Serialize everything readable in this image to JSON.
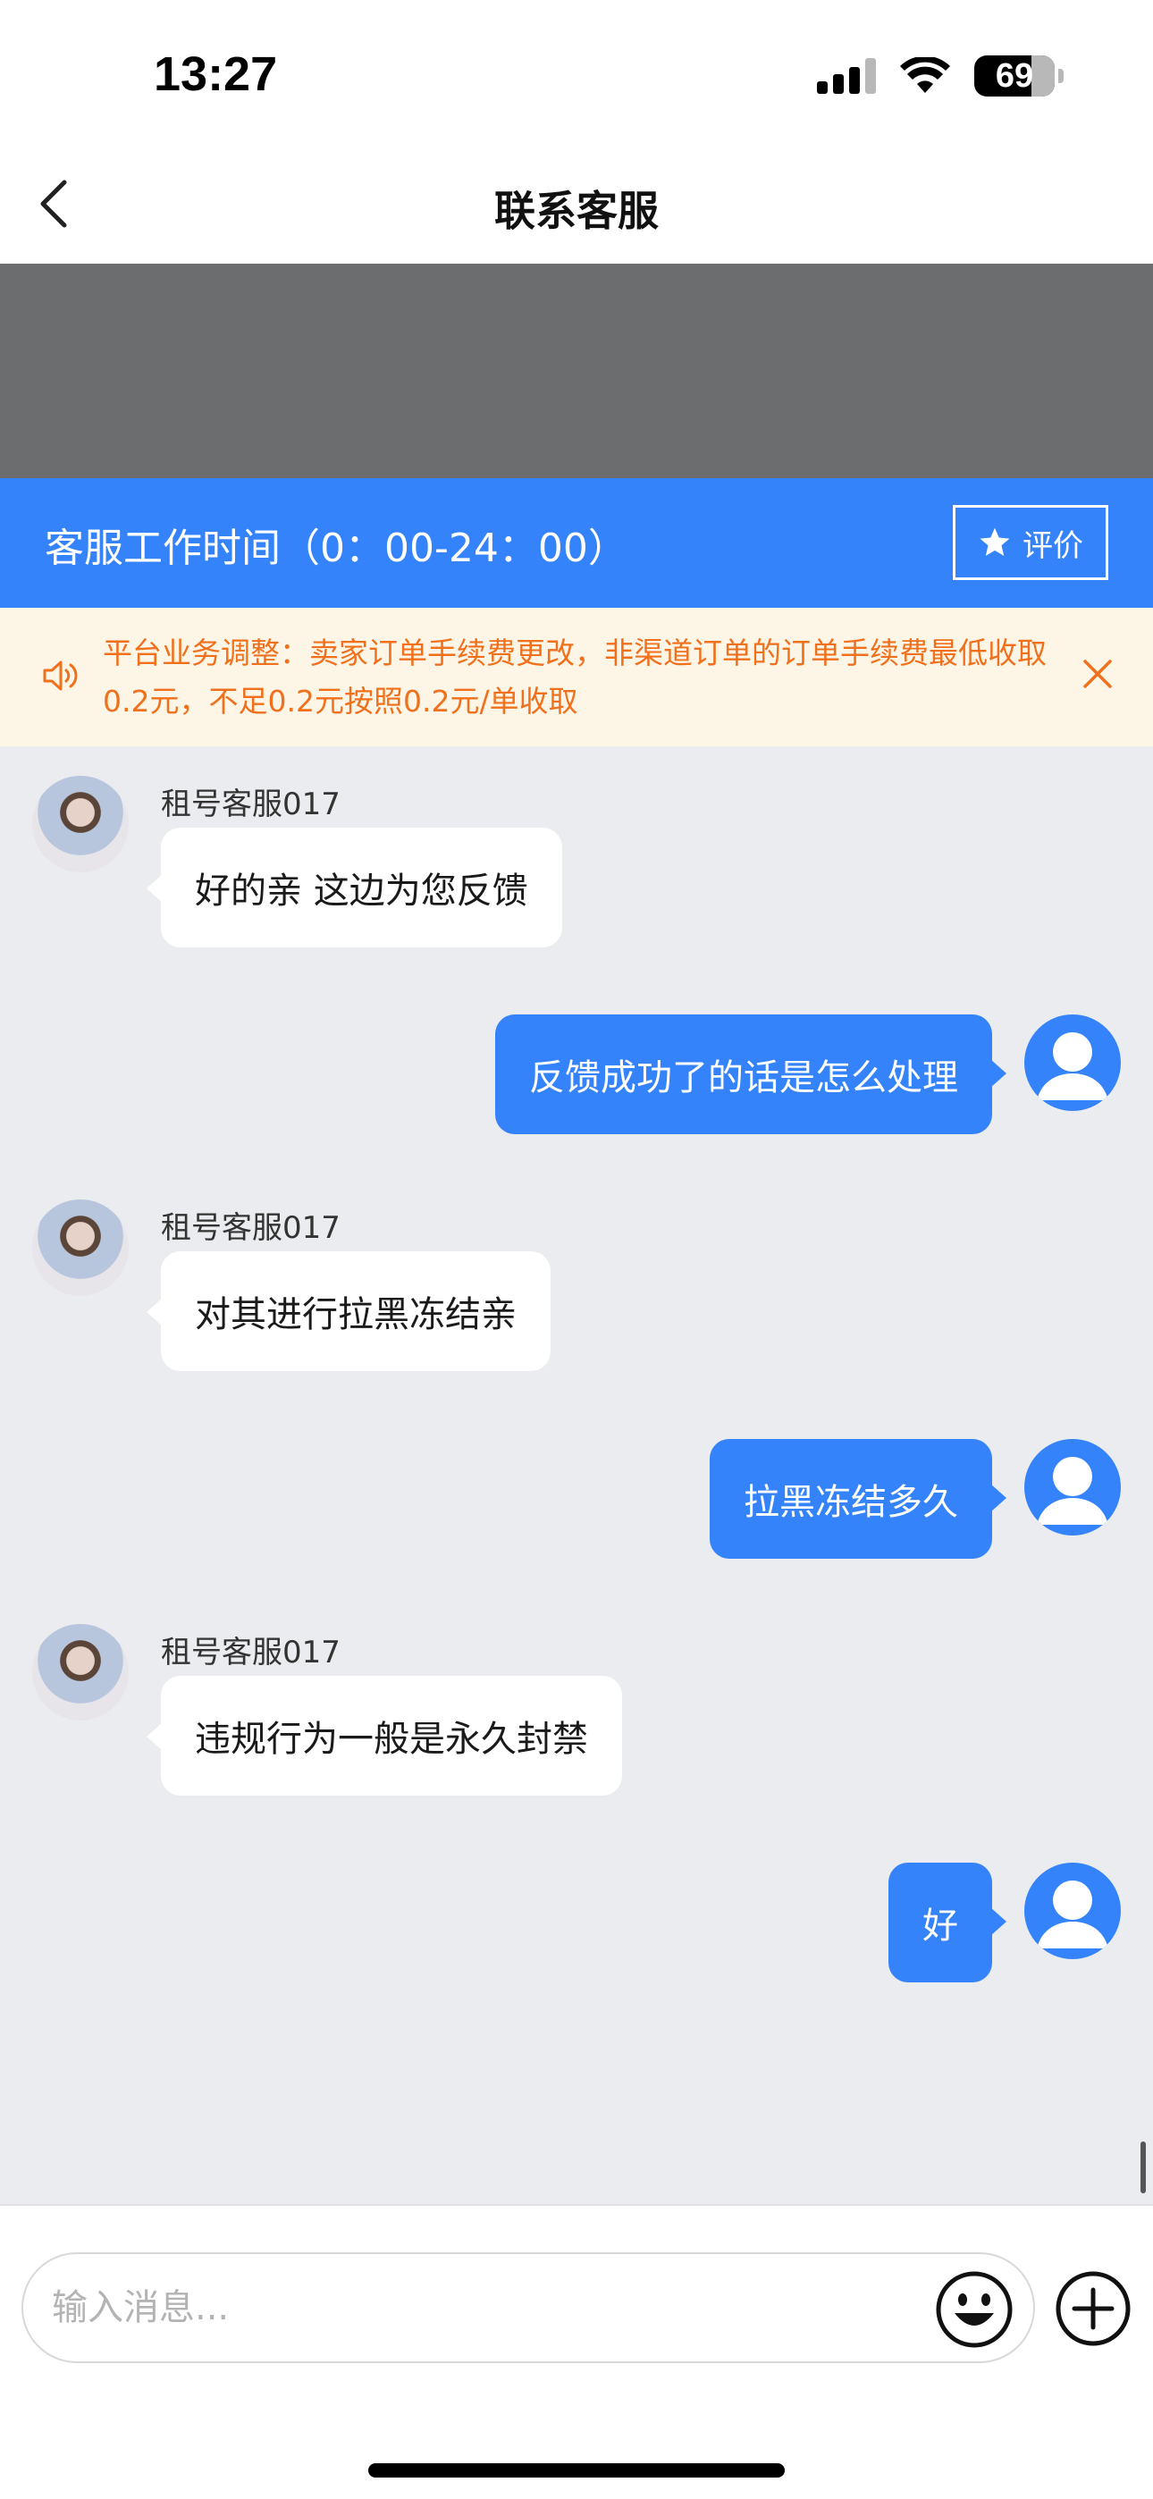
{
  "status_bar": {
    "time": "13:27",
    "battery": "69"
  },
  "nav": {
    "title": "联系客服"
  },
  "hours_bar": {
    "text": "客服工作时间（0：00-24：00）",
    "rate_label": "评价"
  },
  "notice": {
    "text": "平台业务调整：卖家订单手续费更改，非渠道订单的订单手续费最低收取0.2元，不足0.2元按照0.2元/单收取"
  },
  "messages": [
    {
      "sender": "agent",
      "name": "租号客服017",
      "text": "好的亲  这边为您反馈"
    },
    {
      "sender": "user",
      "text": "反馈成功了的话是怎么处理"
    },
    {
      "sender": "agent",
      "name": "租号客服017",
      "text": "对其进行拉黑冻结亲"
    },
    {
      "sender": "user",
      "text": "拉黑冻结多久"
    },
    {
      "sender": "agent",
      "name": "租号客服017",
      "text": "违规行为一般是永久封禁"
    },
    {
      "sender": "user",
      "text": "好"
    }
  ],
  "input": {
    "placeholder": "输入消息..."
  },
  "colors": {
    "accent": "#3483fa",
    "notice_text": "#f0701c",
    "notice_bg": "#fdf6e7",
    "chat_bg": "#ebecef"
  }
}
